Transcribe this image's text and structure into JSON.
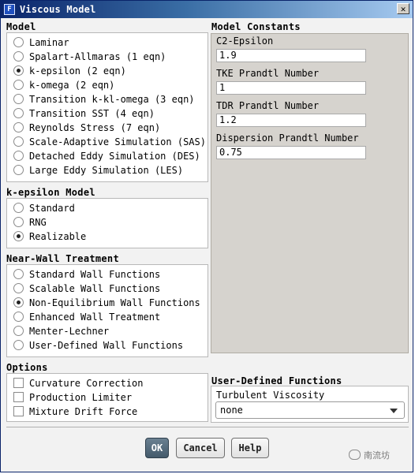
{
  "window": {
    "title": "Viscous Model",
    "icon_name": "fluent-app-icon",
    "close_label": "✕"
  },
  "model": {
    "title": "Model",
    "options": [
      "Laminar",
      "Spalart-Allmaras (1 eqn)",
      "k-epsilon (2 eqn)",
      "k-omega (2 eqn)",
      "Transition k-kl-omega (3 eqn)",
      "Transition SST (4 eqn)",
      "Reynolds Stress (7 eqn)",
      "Scale-Adaptive Simulation (SAS)",
      "Detached Eddy Simulation (DES)",
      "Large Eddy Simulation (LES)"
    ],
    "selected_index": 2
  },
  "kepsilon_model": {
    "title": "k-epsilon Model",
    "options": [
      "Standard",
      "RNG",
      "Realizable"
    ],
    "selected_index": 2
  },
  "near_wall": {
    "title": "Near-Wall Treatment",
    "options": [
      "Standard Wall Functions",
      "Scalable Wall Functions",
      "Non-Equilibrium Wall Functions",
      "Enhanced Wall Treatment",
      "Menter-Lechner",
      "User-Defined Wall Functions"
    ],
    "selected_index": 2
  },
  "options": {
    "title": "Options",
    "items": [
      {
        "label": "Curvature Correction",
        "checked": false
      },
      {
        "label": "Production Limiter",
        "checked": false
      },
      {
        "label": "Mixture Drift Force",
        "checked": false
      }
    ]
  },
  "constants": {
    "title": "Model Constants",
    "fields": [
      {
        "label": "C2-Epsilon",
        "value": "1.9"
      },
      {
        "label": "TKE Prandtl Number",
        "value": "1"
      },
      {
        "label": "TDR Prandtl Number",
        "value": "1.2"
      },
      {
        "label": "Dispersion Prandtl Number",
        "value": "0.75"
      }
    ]
  },
  "udf": {
    "title": "User-Defined Functions",
    "label": "Turbulent Viscosity",
    "value": "none"
  },
  "buttons": {
    "ok": "OK",
    "cancel": "Cancel",
    "help": "Help"
  },
  "watermark": {
    "text": "南流坊"
  }
}
